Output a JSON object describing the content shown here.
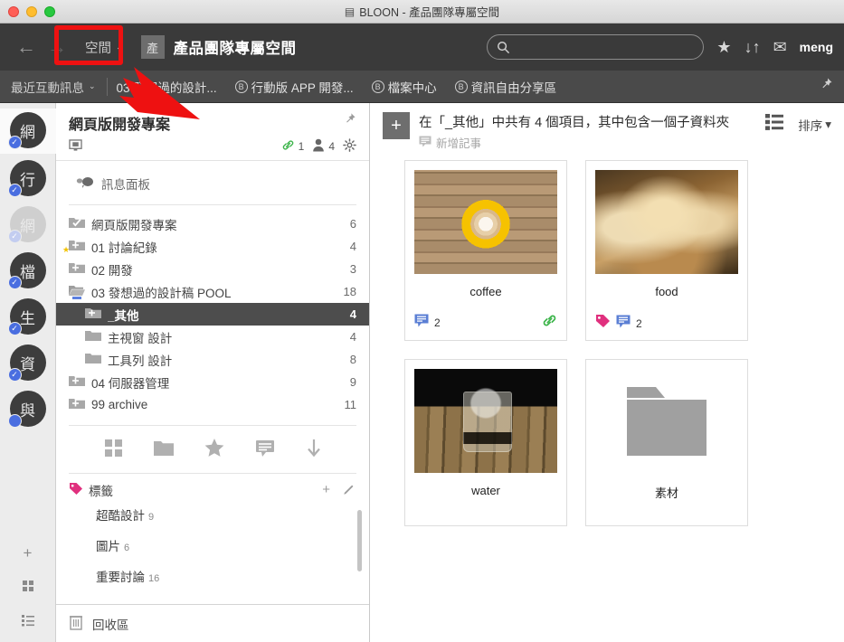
{
  "window": {
    "title": "BLOON - 產品團隊專屬空間",
    "app_icon": "app-icon"
  },
  "toolbar": {
    "back_icon": "←",
    "forward_icon": "→",
    "space_label": "空間",
    "space_caret": "⌄",
    "space_badge": "產",
    "space_title": "產品團隊專屬空間",
    "search_placeholder": "",
    "search_value": "",
    "star_icon": "★",
    "sort_icon": "↓↑",
    "mail_icon": "✉",
    "user_name": "meng"
  },
  "tabbar": {
    "recent_label": "最近互動訊息",
    "recent_caret": "⌄",
    "tabs": [
      {
        "badge": "",
        "label": "03 發想過的設計..."
      },
      {
        "badge": "B",
        "label": "行動版 APP 開發..."
      },
      {
        "badge": "B",
        "label": "檔案中心"
      },
      {
        "badge": "B",
        "label": "資訊自由分享區"
      }
    ],
    "pin_icon": "pin-icon"
  },
  "rail": {
    "items": [
      {
        "label": "網",
        "badge": "✓",
        "state": "active"
      },
      {
        "label": "行",
        "badge": "✓",
        "state": "normal"
      },
      {
        "label": "網",
        "badge": "✓",
        "state": "dim"
      },
      {
        "label": "檔",
        "badge": "✓",
        "state": "normal"
      },
      {
        "label": "生",
        "badge": "✓",
        "state": "normal"
      },
      {
        "label": "資",
        "badge": "✓",
        "state": "normal"
      },
      {
        "label": "與",
        "badge": "",
        "state": "normal"
      }
    ],
    "bottom": [
      {
        "icon": "plus-icon",
        "glyph": "+"
      },
      {
        "icon": "grid-icon",
        "glyph": "▦"
      },
      {
        "icon": "list-icon",
        "glyph": "☰"
      }
    ]
  },
  "tree": {
    "title": "網頁版開發專案",
    "pin_icon": "pin-icon",
    "monitor_icon": "monitor-icon",
    "link_count": "1",
    "member_count": "4",
    "gear_icon": "gear-icon",
    "message_panel": "訊息面板",
    "rows": [
      {
        "label": "網頁版開發專案",
        "count": "6",
        "indent": 0,
        "icon": "folder-check",
        "selected": false
      },
      {
        "label": "01 討論紀錄",
        "count": "4",
        "indent": 1,
        "icon": "folder-plus-star",
        "selected": false
      },
      {
        "label": "02 開發",
        "count": "3",
        "indent": 1,
        "icon": "folder-plus",
        "selected": false
      },
      {
        "label": "03 發想過的設計稿 POOL",
        "count": "18",
        "indent": 1,
        "icon": "folder-open-minus",
        "selected": false
      },
      {
        "label": "_其他",
        "count": "4",
        "indent": 2,
        "icon": "folder-plus",
        "selected": true
      },
      {
        "label": "主視窗 設計",
        "count": "4",
        "indent": 2,
        "icon": "folder",
        "selected": false
      },
      {
        "label": "工具列 設計",
        "count": "8",
        "indent": 2,
        "icon": "folder",
        "selected": false
      },
      {
        "label": "04 伺服器管理",
        "count": "9",
        "indent": 1,
        "icon": "folder-plus",
        "selected": false
      },
      {
        "label": "99 archive",
        "count": "11",
        "indent": 1,
        "icon": "folder-plus",
        "selected": false
      }
    ],
    "icon_row": [
      {
        "name": "grid-view-icon",
        "glyph": "▦"
      },
      {
        "name": "folder-icon",
        "glyph": "📁"
      },
      {
        "name": "star-icon",
        "glyph": "★"
      },
      {
        "name": "comment-icon",
        "glyph": "💬"
      },
      {
        "name": "download-icon",
        "glyph": "↓"
      }
    ],
    "tags_section": {
      "label": "標籤",
      "tag_icon": "tag-icon",
      "add_icon": "+",
      "edit_icon": "✎",
      "items": [
        {
          "label": "超酷設計",
          "count": "9"
        },
        {
          "label": "圖片",
          "count": "6"
        },
        {
          "label": "重要討論",
          "count": "16"
        }
      ]
    },
    "trash": {
      "label": "回收區",
      "icon": "trash-icon"
    }
  },
  "main": {
    "add_button": "+",
    "header_title": "在「_其他」中共有 4 個項目，其中包含一個子資料夾",
    "header_sub": "新增記事",
    "header_sub_icon": "note-icon",
    "list_view_icon": "list-view-icon",
    "sort_label": "排序",
    "sort_caret": "▾",
    "cards": [
      {
        "name": "coffee",
        "thumb": "th-coffee",
        "comments": "2",
        "has_tag": false,
        "has_link": true
      },
      {
        "name": "food",
        "thumb": "th-food",
        "comments": "2",
        "has_tag": true,
        "has_link": false
      },
      {
        "name": "water",
        "thumb": "th-water",
        "comments": "",
        "has_tag": false,
        "has_link": false
      },
      {
        "name": "素材",
        "thumb": "th-folder",
        "comments": "",
        "has_tag": false,
        "has_link": false
      }
    ]
  },
  "annotation": {
    "color": "#ee1111",
    "shape": "rectangle-and-arrow",
    "target": "空間"
  }
}
